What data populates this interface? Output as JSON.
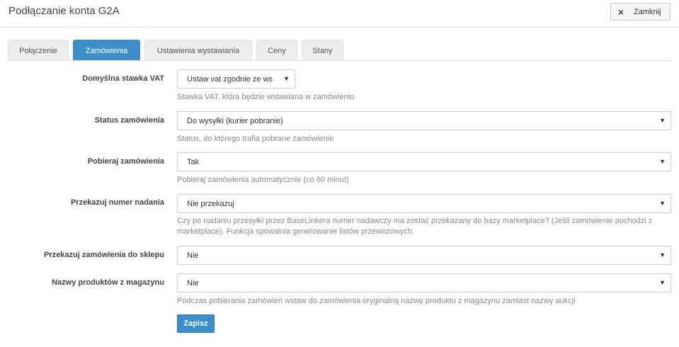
{
  "header": {
    "title": "Podłączanie konta G2A",
    "close_label": "Zamknij",
    "close_icon": "×"
  },
  "tabs": [
    {
      "label": "Połączenie",
      "active": false
    },
    {
      "label": "Zamówienia",
      "active": true
    },
    {
      "label": "Ustawienia wystawiania",
      "active": false
    },
    {
      "label": "Ceny",
      "active": false
    },
    {
      "label": "Stany",
      "active": false
    }
  ],
  "form": {
    "vat": {
      "label": "Domyślna stawka VAT",
      "value": "Ustaw vat zgodnie ze ws",
      "help": "Stawka VAT, która będzie wstawiana w zamówieniu"
    },
    "status": {
      "label": "Status zamówienia",
      "value": "Do wysyłki (kurier pobranie)",
      "help": "Status, do którego trafia pobrane zamówienie"
    },
    "fetch": {
      "label": "Pobieraj zamówienia",
      "value": "Tak",
      "help": "Pobieraj zamówienia automatycznie (co 60 minut)"
    },
    "tracking": {
      "label": "Przekazuj numer nadania",
      "value": "Nie przekazuj",
      "help_line1": "Czy po nadaniu przesyłki przez BaseLinkera numer nadawczy ma zostać przekazany do bazy marketplace? (Jeśli zamówienie pochodzi z",
      "help_line2": "marketplace). Funkcja spowalnia generowanie listów przewozowych."
    },
    "shop": {
      "label": "Przekazuj zamówienia do sklepu",
      "value": "Nie"
    },
    "names": {
      "label": "Nazwy produktów z magazynu",
      "value": "Nie",
      "help": "Podczas pobierania zamówień wstaw do zamówienia oryginalną nazwę produktu z magazynu zamiast nazwy aukcji"
    }
  },
  "dropdown_arrow": "▼",
  "save_label": "Zapisz",
  "colors": {
    "accent": "#3d8fcc"
  }
}
